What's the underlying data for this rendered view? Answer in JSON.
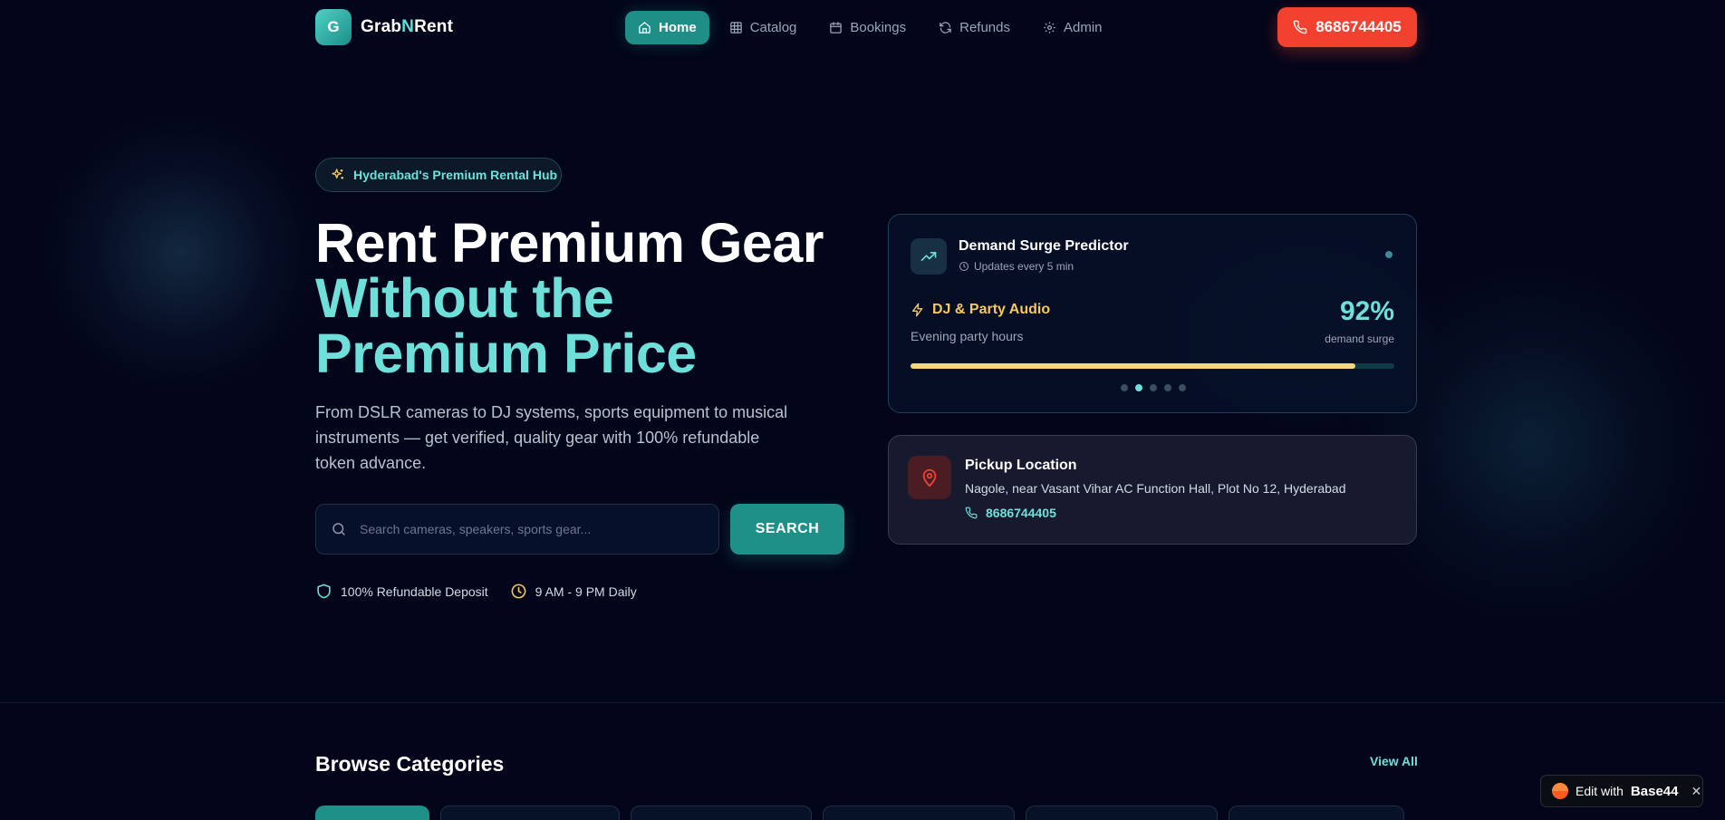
{
  "brand": {
    "logo_letter": "G",
    "name_prefix": "Grab",
    "name_accent": "N",
    "name_suffix": "Rent"
  },
  "nav": {
    "items": [
      {
        "label": "Home",
        "icon": "home-icon",
        "active": true
      },
      {
        "label": "Catalog",
        "icon": "grid-icon",
        "active": false
      },
      {
        "label": "Bookings",
        "icon": "calendar-icon",
        "active": false
      },
      {
        "label": "Refunds",
        "icon": "refresh-icon",
        "active": false
      },
      {
        "label": "Admin",
        "icon": "gear-icon",
        "active": false
      }
    ],
    "phone": "8686744405"
  },
  "hero": {
    "badge": "Hyderabad's Premium Rental Hub",
    "title_line1": "Rent Premium Gear",
    "title_line2": "Without the",
    "title_line3": "Premium Price",
    "description": "From DSLR cameras to DJ systems, sports equipment to musical instruments — get verified, quality gear with 100% refundable token advance.",
    "search_placeholder": "Search cameras, speakers, sports gear...",
    "search_button": "SEARCH",
    "features": [
      {
        "label": "100% Refundable Deposit",
        "icon": "shield-icon",
        "color": "#6fe0d9"
      },
      {
        "label": "9 AM - 9 PM Daily",
        "icon": "clock-icon",
        "color": "#f6c85f"
      }
    ]
  },
  "demand": {
    "title": "Demand Surge Predictor",
    "subtitle": "Updates every 5 min",
    "category": "DJ & Party Audio",
    "time_label": "Evening party hours",
    "percent": "92%",
    "percent_value": 0.92,
    "percent_label": "demand surge",
    "slides": 5,
    "active_slide": 1
  },
  "pickup": {
    "title": "Pickup Location",
    "address": "Nagole, near Vasant Vihar AC Function Hall, Plot No 12, Hyderabad",
    "phone": "8686744405"
  },
  "categories": {
    "title": "Browse Categories",
    "view_all": "View All"
  },
  "badge_widget": {
    "prefix": "Edit with",
    "brand": "Base44"
  },
  "colors": {
    "accent": "#1e9088",
    "accent_light": "#6fe0d9",
    "cta": "#f2412f",
    "warning": "#f6c85f",
    "background": "#03051a"
  }
}
